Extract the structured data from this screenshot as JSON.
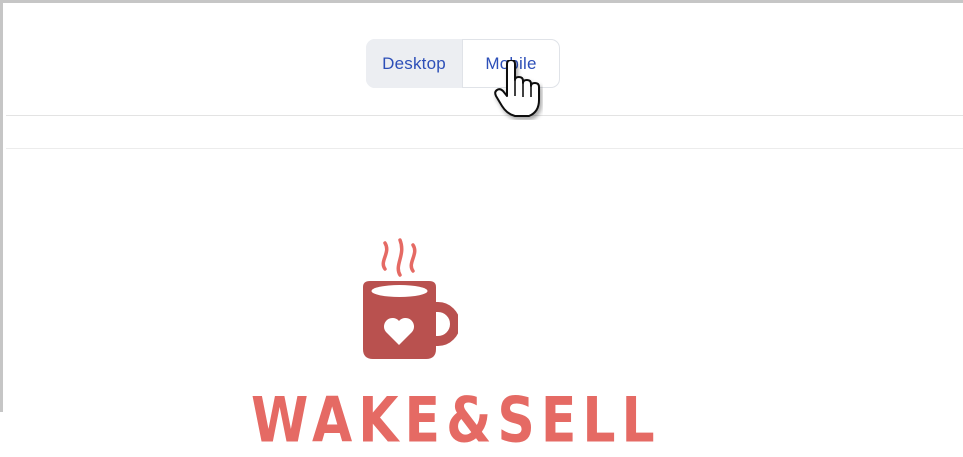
{
  "view_toggle": {
    "options": [
      {
        "label": "Desktop",
        "selected": false
      },
      {
        "label": "Mobile",
        "selected": true
      }
    ]
  },
  "preview": {
    "logo_icon": "coffee-mug-heart-icon",
    "brand_text": "WAKE&SELL",
    "colors": {
      "mug": "#b9514f",
      "steam": "#e56a64",
      "brand": "#e56a64",
      "accent": "#2d4fb8"
    }
  },
  "cursor": {
    "icon": "hand-pointer-icon"
  }
}
